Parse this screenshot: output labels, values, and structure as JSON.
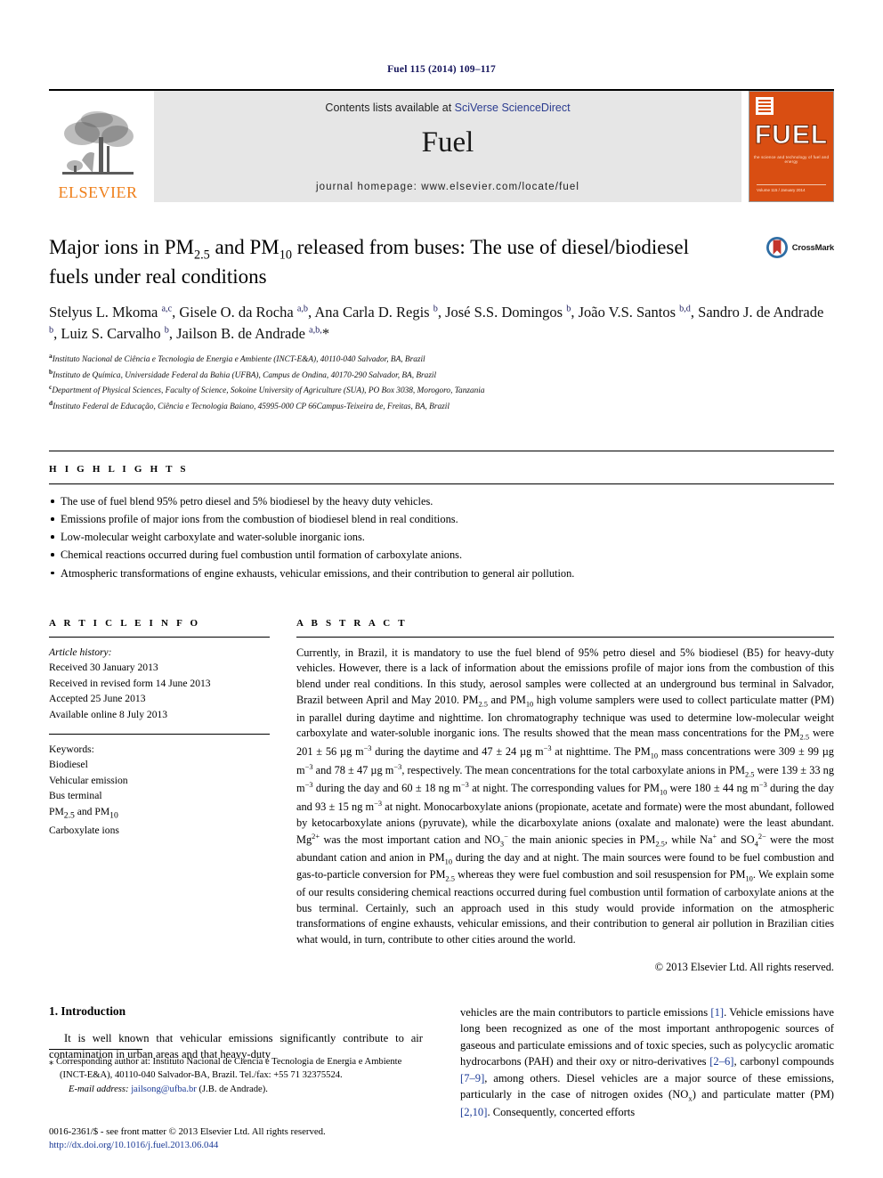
{
  "running_head": "Fuel 115 (2014) 109–117",
  "masthead": {
    "contents_prefix": "Contents lists available at ",
    "contents_link": "SciVerse ScienceDirect",
    "journal_name": "Fuel",
    "homepage": "journal homepage: www.elsevier.com/locate/fuel",
    "publisher_logo_text": "ELSEVIER",
    "cover_title": "FUEL",
    "cover_subtitle": "the science and technology of fuel and energy",
    "cover_footer": "Volume 115 / January 2014"
  },
  "crossmark": {
    "label": "CrossMark"
  },
  "title": {
    "part1": "Major ions in PM",
    "sub1": "2.5",
    "part2": " and PM",
    "sub2": "10",
    "part3": " released from buses: The use of diesel/biodiesel fuels under real conditions"
  },
  "authors_html": "Stelyus L. Mkoma <sup>a,c</sup>, Gisele O. da Rocha <sup>a,b</sup>, Ana Carla D. Regis <sup>b</sup>, José S.S. Domingos <sup>b</sup>, João V.S. Santos <sup>b,d</sup>, Sandro J. de Andrade <sup>b</sup>, Luiz S. Carvalho <sup>b</sup>, Jailson B. de Andrade <sup>a,b,</sup>*",
  "affiliations": [
    {
      "mark": "a",
      "text": "Instituto Nacional de Ciência e Tecnologia de Energia e Ambiente (INCT-E&A), 40110-040 Salvador, BA, Brazil"
    },
    {
      "mark": "b",
      "text": "Instituto de Química, Universidade Federal da Bahia (UFBA), Campus de Ondina, 40170-290 Salvador, BA, Brazil"
    },
    {
      "mark": "c",
      "text": "Department of Physical Sciences, Faculty of Science, Sokoine University of Agriculture (SUA), PO Box 3038, Morogoro, Tanzania"
    },
    {
      "mark": "d",
      "text": "Instituto Federal de Educação, Ciência e Tecnologia Baiano, 45995-000 CP 66Campus-Teixeira de, Freitas, BA, Brazil"
    }
  ],
  "highlights": {
    "heading": "H I G H L I G H T S",
    "items": [
      "The use of fuel blend 95% petro diesel and 5% biodiesel by the heavy duty vehicles.",
      "Emissions profile of major ions from the combustion of biodiesel blend in real conditions.",
      "Low-molecular weight carboxylate and water-soluble inorganic ions.",
      "Chemical reactions occurred during fuel combustion until formation of carboxylate anions.",
      "Atmospheric transformations of engine exhausts, vehicular emissions, and their contribution to general air pollution."
    ]
  },
  "article_info": {
    "heading": "A R T I C L E    I N F O",
    "history_label": "Article history:",
    "history": [
      "Received 30 January 2013",
      "Received in revised form 14 June 2013",
      "Accepted 25 June 2013",
      "Available online 8 July 2013"
    ],
    "keywords_label": "Keywords:",
    "keywords_html": [
      "Biodiesel",
      "Vehicular emission",
      "Bus terminal",
      "PM<sub>2.5</sub> and PM<sub>10</sub>",
      "Carboxylate ions"
    ]
  },
  "abstract": {
    "heading": "A B S T R A C T",
    "text_html": "Currently, in Brazil, it is mandatory to use the fuel blend of 95% petro diesel and 5% biodiesel (B5) for heavy-duty vehicles. However, there is a lack of information about the emissions profile of major ions from the combustion of this blend under real conditions. In this study, aerosol samples were collected at an underground bus terminal in Salvador, Brazil between April and May 2010. PM<sub>2.5</sub> and PM<sub>10</sub> high volume samplers were used to collect particulate matter (PM) in parallel during daytime and nighttime. Ion chromatography technique was used to determine low-molecular weight carboxylate and water-soluble inorganic ions. The results showed that the mean mass concentrations for the PM<sub>2.5</sub> were 201 ± 56 µg m<sup>−3</sup> during the daytime and 47 ± 24 µg m<sup>−3</sup> at nighttime. The PM<sub>10</sub> mass concentrations were 309 ± 99 µg m<sup>−3</sup> and 78 ± 47 µg m<sup>−3</sup>, respectively. The mean concentrations for the total carboxylate anions in PM<sub>2.5</sub> were 139 ± 33 ng m<sup>−3</sup> during the day and 60 ± 18 ng m<sup>−3</sup> at night. The corresponding values for PM<sub>10</sub> were 180 ± 44 ng m<sup>−3</sup> during the day and 93 ± 15 ng m<sup>−3</sup> at night. Monocarboxylate anions (propionate, acetate and formate) were the most abundant, followed by ketocarboxylate anions (pyruvate), while the dicarboxylate anions (oxalate and malonate) were the least abundant. Mg<sup>2+</sup> was the most important cation and NO<sub>3</sub><sup>−</sup> the main anionic species in PM<sub>2.5</sub>, while Na<sup>+</sup> and SO<sub>4</sub><sup>2−</sup> were the most abundant cation and anion in PM<sub>10</sub> during the day and at night. The main sources were found to be fuel combustion and gas-to-particle conversion for PM<sub>2.5</sub> whereas they were fuel combustion and soil resuspension for PM<sub>10</sub>. We explain some of our results considering chemical reactions occurred during fuel combustion until formation of carboxylate anions at the bus terminal. Certainly, such an approach used in this study would provide information on the atmospheric transformations of engine exhausts, vehicular emissions, and their contribution to general air pollution in Brazilian cities what would, in turn, contribute to other cities around the world.",
    "copyright": "© 2013 Elsevier Ltd. All rights reserved."
  },
  "introduction": {
    "heading": "1. Introduction",
    "left_paragraph": "It is well known that vehicular emissions significantly contribute to air contamination in urban areas and that heavy-duty",
    "right_paragraph_html": "vehicles are the main contributors to particle emissions <span class=\"ref\">[1]</span>. Vehicle emissions have long been recognized as one of the most important anthropogenic sources of gaseous and particulate emissions and of toxic species, such as polycyclic aromatic hydrocarbons (PAH) and their oxy or nitro-derivatives <span class=\"ref\">[2–6]</span>, carbonyl compounds <span class=\"ref\">[7–9]</span>, among others. Diesel vehicles are a major source of these emissions, particularly in the case of nitrogen oxides (NO<sub>x</sub>) and particulate matter (PM) <span class=\"ref\">[2,10]</span>. Consequently, concerted efforts"
  },
  "footnotes": {
    "corresponding_html": "⁎ Corresponding author at: Instituto Nacional de Ciencia e Tecnologia de Energia e Ambiente (INCT-E&A), 40110-040 Salvador-BA, Brazil. Tel./fax: +55 71 32375524.",
    "email_label": "E-mail address:",
    "email": "jailsong@ufba.br",
    "email_suffix": "(J.B. de Andrade)."
  },
  "imprint": {
    "line1": "0016-2361/$ - see front matter © 2013 Elsevier Ltd. All rights reserved.",
    "doi": "http://dx.doi.org/10.1016/j.fuel.2013.06.044"
  }
}
